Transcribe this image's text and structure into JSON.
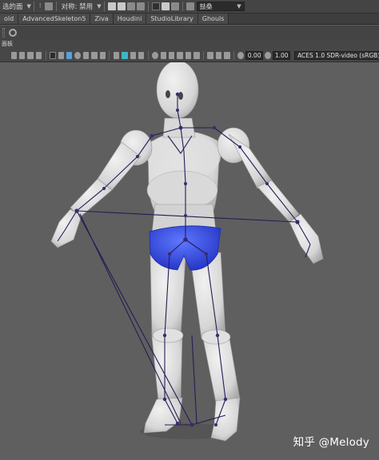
{
  "top_toolbar": {
    "panel_label": "选的面",
    "symmetry_label": "对称: 禁用",
    "target_value": "鼓桑"
  },
  "shelf_tabs": [
    "old",
    "AdvancedSkeleton5",
    "Ziva",
    "Houdini",
    "StudioLibrary",
    "Ghouls"
  ],
  "panel_label": "面板",
  "viewport_toolbar": {
    "exposure": "0.00",
    "gamma": "1.00",
    "color_space": "ACES 1.0 SDR-video (sRGB)"
  },
  "watermark": "知乎 @Melody",
  "colors": {
    "viewport_bg": "#5f5f5f",
    "body": "#e4e4e4",
    "shorts": "#3d4fe0",
    "joints": "#2a1a55"
  }
}
